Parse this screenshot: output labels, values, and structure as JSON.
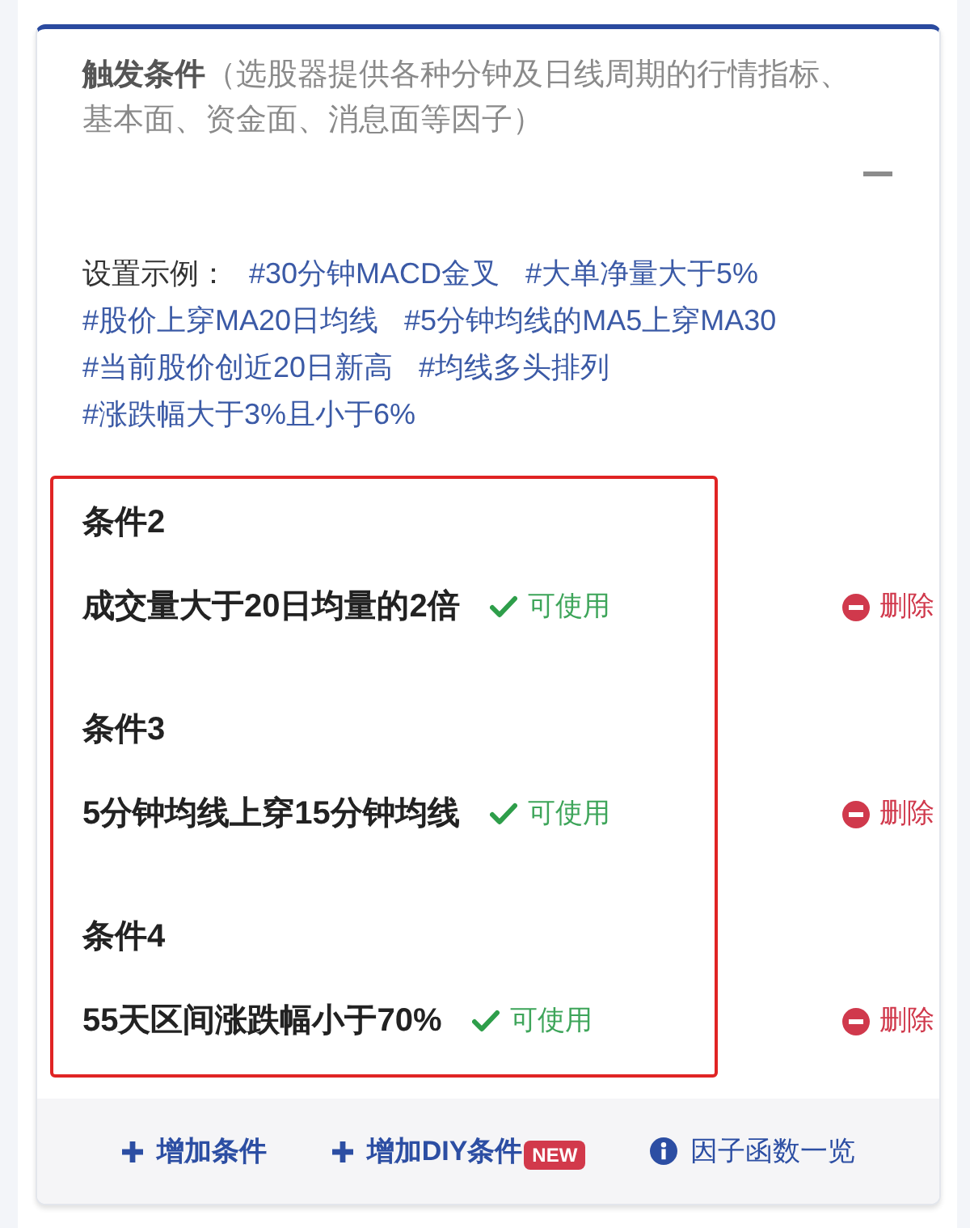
{
  "card": {
    "title": "**触发条件**（选股器提供各种分钟及日线周期的行情指标、基本面、资金面、消息面等因子）",
    "expanded": true
  },
  "examples": {
    "label": "设置示例：",
    "tags": [
      "#30分钟MACD金叉",
      "#大单净量大于5%",
      "#股价上穿MA20日均线",
      "#5分钟均线的MA5上穿MA30",
      "#当前股价创近20日新高",
      "#均线多头排列",
      "#涨跌幅大于3%且小于6%"
    ]
  },
  "conditions": {
    "highlighted": true,
    "items": [
      {
        "label": "条件2",
        "text": "成交量大于20日均量的2倍",
        "valid": true,
        "status": "可使用",
        "delete": "删除"
      },
      {
        "label": "条件3",
        "text": "5分钟均线上穿15分钟均线",
        "valid": true,
        "status": "可使用",
        "delete": "删除"
      },
      {
        "label": "条件4",
        "text": "55天区间涨跌幅小于70%",
        "valid": true,
        "status": "可使用",
        "delete": "删除"
      }
    ]
  },
  "footer": {
    "actions": [
      {
        "kind": "add",
        "label": "增加条件"
      },
      {
        "kind": "add",
        "label": "增加DIY条件",
        "badge": "NEW"
      },
      {
        "kind": "info",
        "label": "因子函数一览"
      }
    ]
  }
}
